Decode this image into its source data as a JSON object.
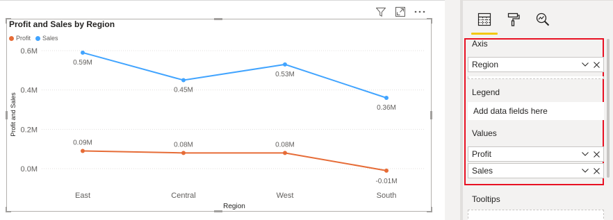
{
  "visual": {
    "title": "Profit and Sales by Region",
    "header_icons": [
      "filter-icon",
      "focus-mode-icon",
      "more-options-icon"
    ]
  },
  "chart_data": {
    "type": "line",
    "title": "Profit and Sales by Region",
    "xlabel": "Region",
    "ylabel": "Profit and Sales",
    "categories": [
      "East",
      "Central",
      "West",
      "South"
    ],
    "ylim": [
      -0.05,
      0.65
    ],
    "yticks": [
      0.0,
      0.2,
      0.4,
      0.6
    ],
    "ytick_labels": [
      "0.0M",
      "0.2M",
      "0.4M",
      "0.6M"
    ],
    "grid": true,
    "legend": "top-left",
    "series": [
      {
        "name": "Profit",
        "color": "#e66c37",
        "values": [
          0.09,
          0.08,
          0.08,
          -0.01
        ],
        "labels": [
          "0.09M",
          "0.08M",
          "0.08M",
          "-0.01M"
        ]
      },
      {
        "name": "Sales",
        "color": "#41a4ff",
        "values": [
          0.59,
          0.45,
          0.53,
          0.36
        ],
        "labels": [
          "0.59M",
          "0.45M",
          "0.53M",
          "0.36M"
        ]
      }
    ]
  },
  "pane": {
    "tabs": [
      {
        "icon": "fields-icon",
        "active": true
      },
      {
        "icon": "format-paint-roller-icon",
        "active": false
      },
      {
        "icon": "analytics-magnifier-icon",
        "active": false
      }
    ],
    "sections": {
      "axis": {
        "label": "Axis",
        "fields": [
          "Region"
        ]
      },
      "legend": {
        "label": "Legend",
        "placeholder": "Add data fields here"
      },
      "values": {
        "label": "Values",
        "fields": [
          "Profit",
          "Sales"
        ]
      },
      "tooltips": {
        "label": "Tooltips"
      }
    },
    "highlight_color": "#e81123",
    "accent_color": "#f2c811"
  }
}
